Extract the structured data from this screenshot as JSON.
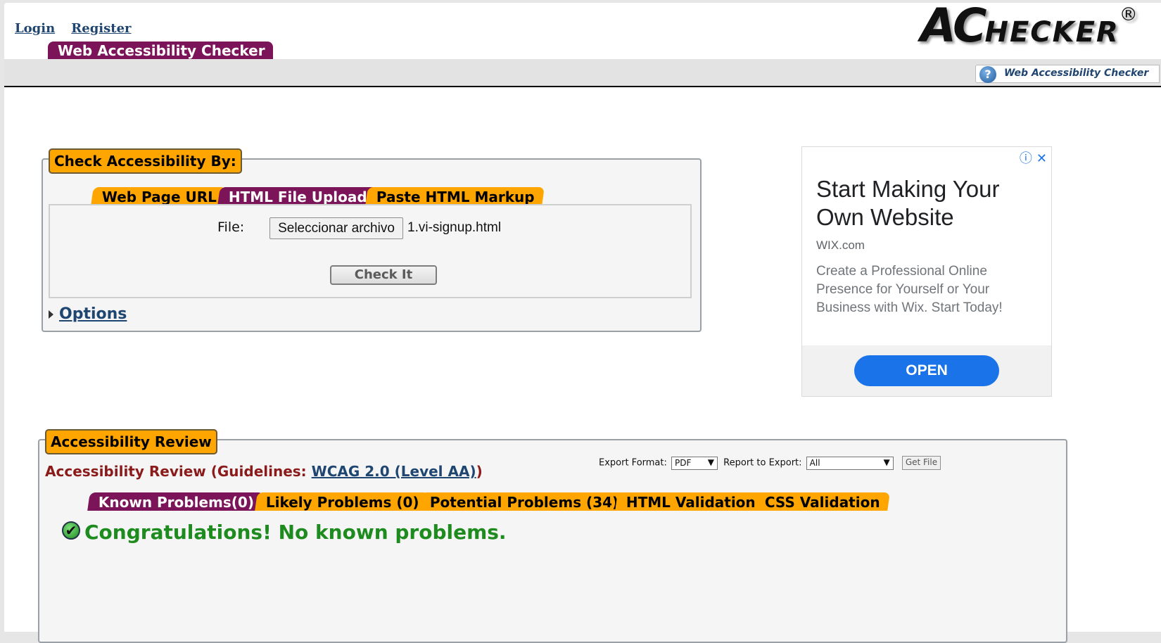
{
  "nav": {
    "login": "Login",
    "register": "Register"
  },
  "logo": {
    "ac": "AC",
    "checker": "HECKER",
    "reg": "®"
  },
  "header": {
    "tab_label": "Web Accessibility Checker",
    "help_label": "Web Accessibility Checker",
    "help_glyph": "?"
  },
  "check": {
    "legend": "Check Accessibility By:",
    "tabs": [
      "Web Page URL",
      "HTML File Upload",
      "Paste HTML Markup"
    ],
    "active_tab": 1,
    "file_label": "File:",
    "file_button": "Seleccionar archivo",
    "file_name": "1.vi-signup.html",
    "check_button": "Check It",
    "options_label": "Options"
  },
  "ad": {
    "info_glyph": "ⓘ",
    "close_glyph": "✕",
    "headline": "Start Making Your Own Website",
    "source": "WIX.com",
    "description": "Create a Professional Online Presence for Yourself or Your Business with Wix. Start Today!",
    "cta": "OPEN"
  },
  "review": {
    "legend": "Accessibility Review",
    "title_prefix": "Accessibility Review (Guidelines: ",
    "guideline_link": "WCAG 2.0 (Level AA)",
    "title_suffix": ")",
    "export_format_label": "Export Format:",
    "export_format_value": "PDF",
    "report_label": "Report to Export:",
    "report_value": "All",
    "get_file": "Get File",
    "tabs": [
      "Known Problems(0)",
      "Likely Problems (0)",
      "Potential Problems (34)",
      "HTML Validation",
      "CSS Validation"
    ],
    "active_tab": 0,
    "message": "Congratulations! No known problems.",
    "ok_glyph": "✔"
  },
  "colors": {
    "orange": "#ffa500",
    "purple": "#7b1458",
    "link": "#1f4571",
    "success": "#1e8b1e",
    "review_title": "#8b1a1a",
    "ad_button": "#1a73e8"
  }
}
